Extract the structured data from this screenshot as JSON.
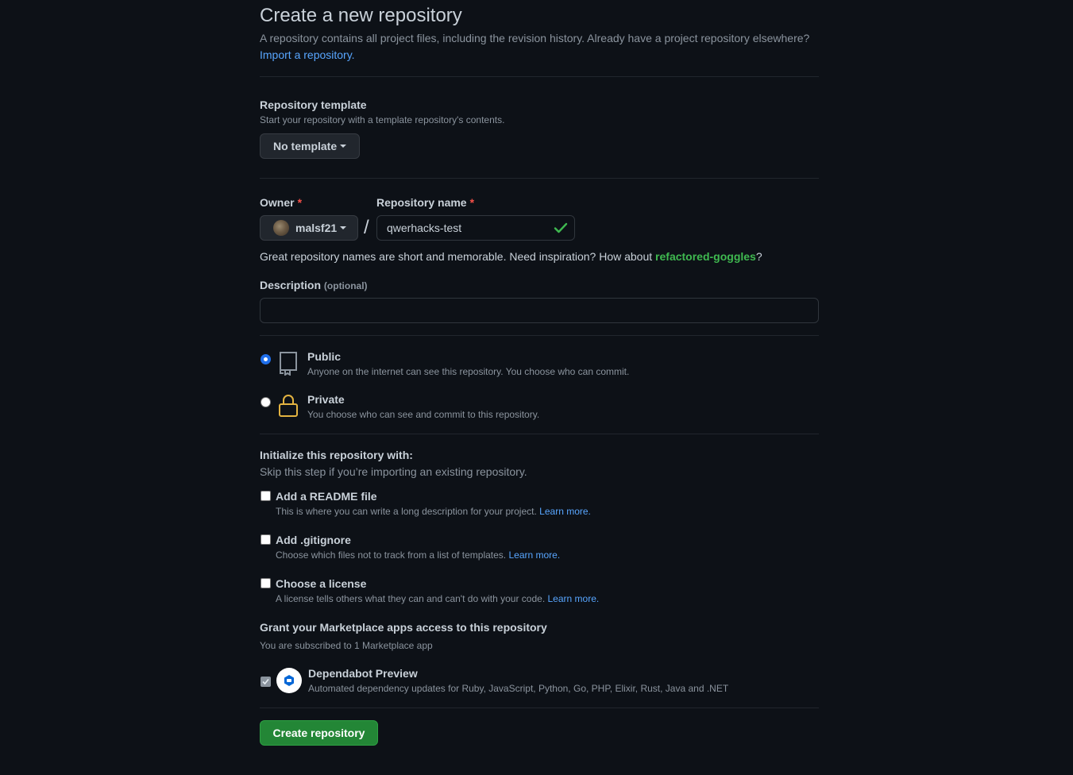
{
  "header": {
    "title": "Create a new repository",
    "intro_text": "A repository contains all project files, including the revision history. Already have a project repository elsewhere?",
    "import_link": "Import a repository."
  },
  "template": {
    "label": "Repository template",
    "description": "Start your repository with a template repository's contents.",
    "button_label": "No template"
  },
  "owner": {
    "label": "Owner",
    "required_mark": "*",
    "value": "malsf21"
  },
  "repo_name": {
    "label": "Repository name",
    "required_mark": "*",
    "value": "qwerhacks-test",
    "separator": "/"
  },
  "suggestion": {
    "text": "Great repository names are short and memorable. Need inspiration? How about",
    "name": "refactored-goggles",
    "suffix": "?"
  },
  "description": {
    "label": "Description",
    "optional": "(optional)",
    "value": "",
    "placeholder": ""
  },
  "visibility": {
    "options": [
      {
        "label": "Public",
        "description": "Anyone on the internet can see this repository. You choose who can commit.",
        "selected": true
      },
      {
        "label": "Private",
        "description": "You choose who can see and commit to this repository.",
        "selected": false
      }
    ]
  },
  "initialize": {
    "title": "Initialize this repository with:",
    "subtitle": "Skip this step if you’re importing an existing repository.",
    "options": [
      {
        "label": "Add a README file",
        "description": "This is where you can write a long description for your project.",
        "link": "Learn more."
      },
      {
        "label": "Add .gitignore",
        "description": "Choose which files not to track from a list of templates.",
        "link": "Learn more."
      },
      {
        "label": "Choose a license",
        "description": "A license tells others what they can and can't do with your code.",
        "link": "Learn more."
      }
    ]
  },
  "marketplace": {
    "title": "Grant your Marketplace apps access to this repository",
    "subtitle": "You are subscribed to 1 Marketplace app",
    "app_name": "Dependabot Preview",
    "app_description": "Automated dependency updates for Ruby, JavaScript, Python, Go, PHP, Elixir, Rust, Java and .NET"
  },
  "actions": {
    "create_label": "Create repository"
  },
  "colors": {
    "background": "#0d1117",
    "accent_link": "#58a6ff",
    "success_green": "#3fb950",
    "button_green": "#238636",
    "required_red": "#f85149",
    "lock_yellow": "#e3b341"
  }
}
